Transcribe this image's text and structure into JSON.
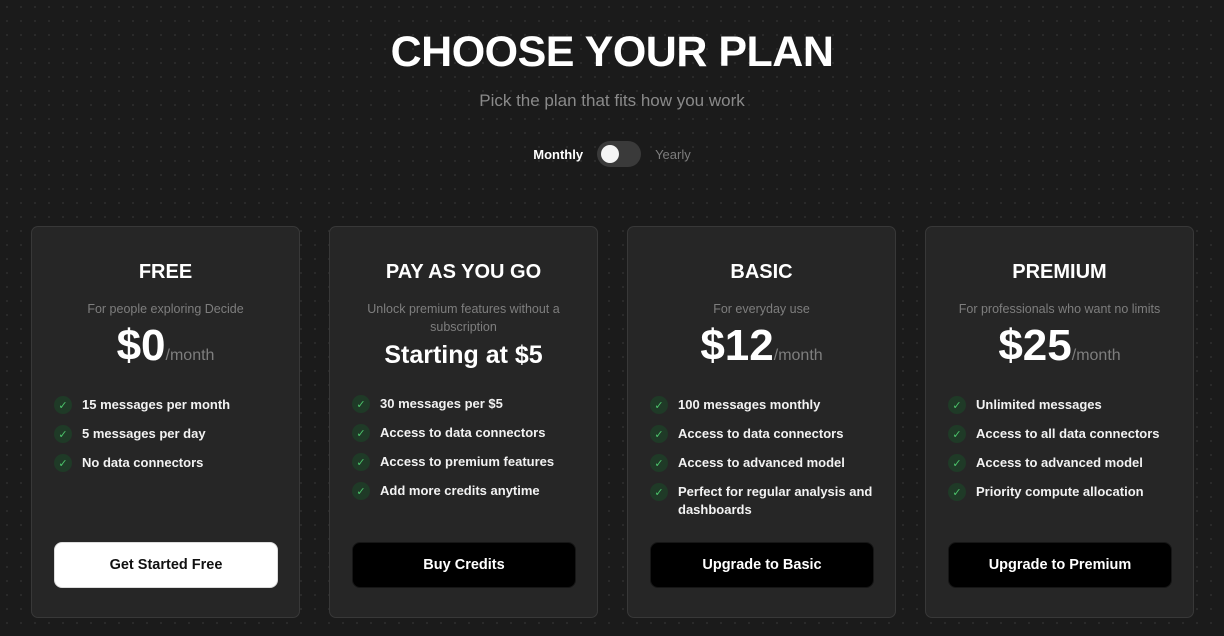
{
  "header": {
    "title": "CHOOSE YOUR PLAN",
    "subtitle": "Pick the plan that fits how you work"
  },
  "billing_toggle": {
    "monthly_label": "Monthly",
    "yearly_label": "Yearly",
    "selected": "Monthly"
  },
  "plans": [
    {
      "name": "FREE",
      "description": "For people exploring Decide",
      "price": "$0",
      "period": "/month",
      "features": [
        "15 messages per month",
        "5 messages per day",
        "No data connectors"
      ],
      "cta": "Get Started Free"
    },
    {
      "name": "PAY AS YOU GO",
      "description": "Unlock premium features without a subscription",
      "price": "Starting at $5",
      "period": "",
      "features": [
        "30 messages per $5",
        "Access to data connectors",
        "Access to premium features",
        "Add more credits anytime"
      ],
      "cta": "Buy Credits"
    },
    {
      "name": "BASIC",
      "description": "For everyday use",
      "price": "$12",
      "period": "/month",
      "features": [
        "100 messages monthly",
        "Access to data connectors",
        "Access to advanced model",
        "Perfect for regular analysis and dashboards"
      ],
      "cta": "Upgrade to Basic"
    },
    {
      "name": "PREMIUM",
      "description": "For professionals who want no limits",
      "price": "$25",
      "period": "/month",
      "features": [
        "Unlimited messages",
        "Access to all data connectors",
        "Access to advanced model",
        "Priority compute allocation"
      ],
      "cta": "Upgrade to Premium"
    }
  ],
  "icons": {
    "feature_check": "check-icon"
  },
  "colors": {
    "background": "#1b1b1b",
    "card": "#262626",
    "check_green": "#4cc36b",
    "muted_text": "#7e7e7e"
  }
}
